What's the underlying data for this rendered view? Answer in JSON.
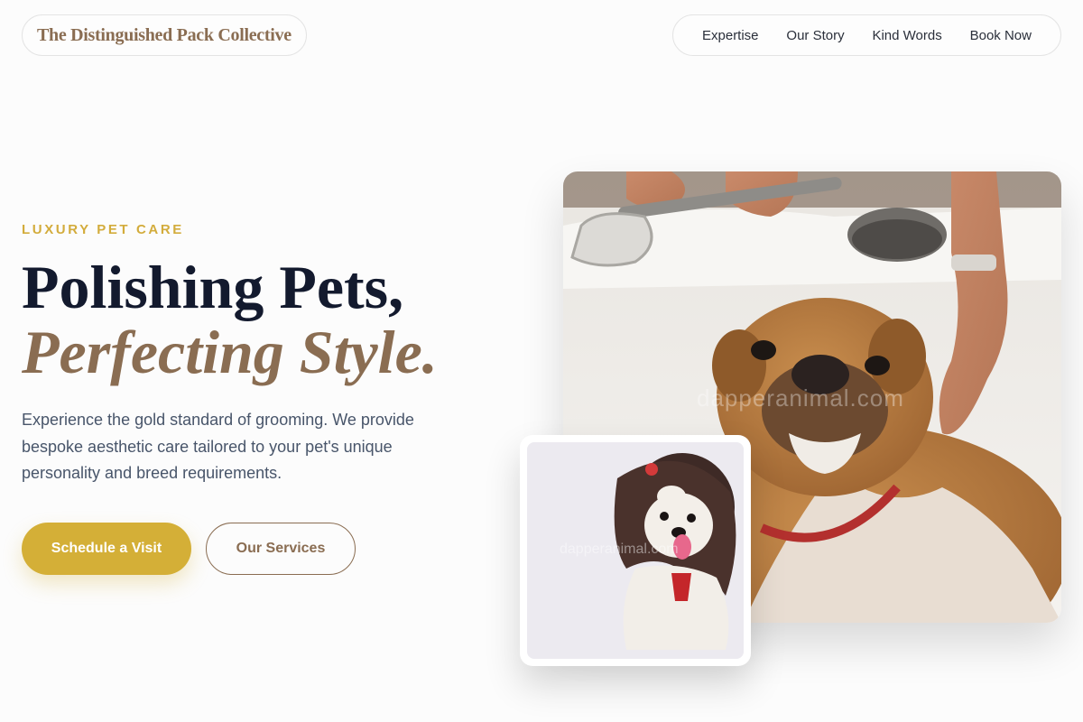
{
  "header": {
    "brand": "The Distinguished Pack Collective",
    "nav": [
      "Expertise",
      "Our Story",
      "Kind Words",
      "Book Now"
    ]
  },
  "hero": {
    "eyebrow": "LUXURY PET CARE",
    "headline_line1": "Polishing Pets,",
    "headline_line2": "Perfecting Style.",
    "description": "Experience the gold standard of grooming. We provide bespoke aesthetic care tailored to your pet's unique personality and breed requirements.",
    "primary_cta": "Schedule a Visit",
    "secondary_cta": "Our Services"
  },
  "images": {
    "main_watermark": "dapperanimal.com",
    "inset_watermark": "dapperanimal.com"
  },
  "colors": {
    "accent_gold": "#d4af37",
    "brand_brown": "#8a6d52",
    "heading_navy": "#131a2e",
    "body_text": "#48556a"
  }
}
